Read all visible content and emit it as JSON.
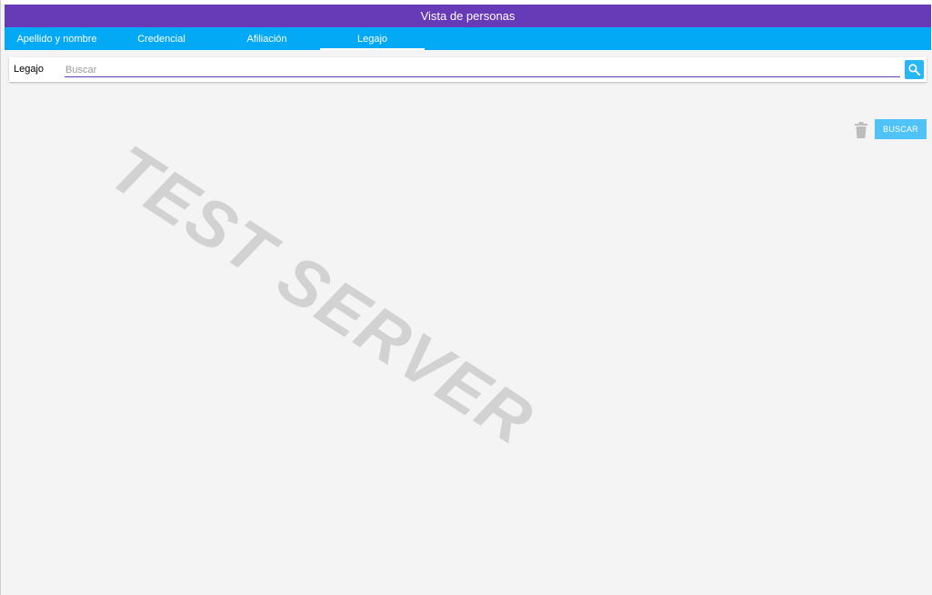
{
  "header": {
    "title": "Vista de personas"
  },
  "tabs": [
    {
      "label": "Apellido y nombre",
      "active": false
    },
    {
      "label": "Credencial",
      "active": false
    },
    {
      "label": "Afiliación",
      "active": false
    },
    {
      "label": "Legajo",
      "active": true
    }
  ],
  "search": {
    "label": "Legajo",
    "placeholder": "Buscar",
    "value": "",
    "button_icon": "search-icon"
  },
  "actions": {
    "clear_icon": "trash-icon",
    "buscar_label": "BUSCAR"
  },
  "watermark": {
    "text": "TEST SERVER"
  },
  "colors": {
    "header": "#673ab7",
    "tabs": "#03a9f4",
    "accent": "#29b6f6",
    "background": "#f4f4f4",
    "watermark": "#d2d2d2"
  }
}
